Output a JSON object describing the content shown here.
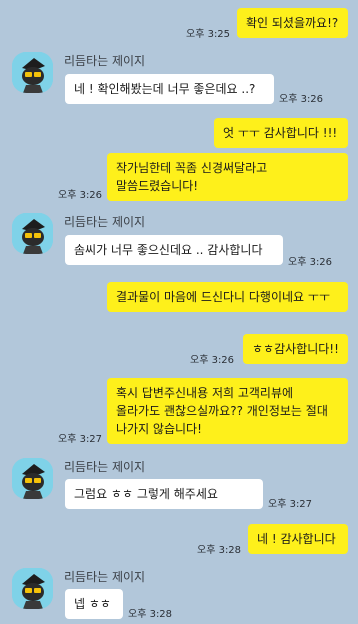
{
  "sender_name": "리듬타는 제이지",
  "colors": {
    "background": "#b2c7da",
    "my_bubble": "#fef01b",
    "their_bubble": "#ffffff",
    "avatar_bg": "#7fd2e8"
  },
  "messages": [
    {
      "from": "me",
      "text": "확인 되셨을까요!?",
      "time": "오후 3:25"
    },
    {
      "from": "other",
      "text": "네 ! 확인해봤는데 너무 좋은데요 ..?",
      "time": "오후 3:26"
    },
    {
      "from": "me",
      "text": "엇 ㅜㅜ 감사합니다 !!!",
      "time": ""
    },
    {
      "from": "me",
      "text": "작가님한테 꼭좀 신경써달라고 말씀드렸습니다!",
      "time": "오후 3:26"
    },
    {
      "from": "other",
      "text": "솜씨가 너무 좋으신데요 .. 감사합니다",
      "time": "오후 3:26"
    },
    {
      "from": "me",
      "text": "결과물이 마음에 드신다니 다행이네요 ㅜㅜ",
      "time": ""
    },
    {
      "from": "me",
      "text": "ㅎㅎ감사합니다!!",
      "time": "오후 3:26"
    },
    {
      "from": "me",
      "text": "혹시 답변주신내용 저희 고객리뷰에 올라가도 괜찮으실까요?? 개인정보는 절대 나가지 않습니다!",
      "time": "오후 3:27"
    },
    {
      "from": "other",
      "text": "그럼요 ㅎㅎ 그렇게 해주세요",
      "time": "오후 3:27"
    },
    {
      "from": "me",
      "text": "네 ! 감사합니다",
      "time": "오후 3:28"
    },
    {
      "from": "other",
      "text": "넵 ㅎㅎ",
      "time": "오후 3:28"
    }
  ]
}
